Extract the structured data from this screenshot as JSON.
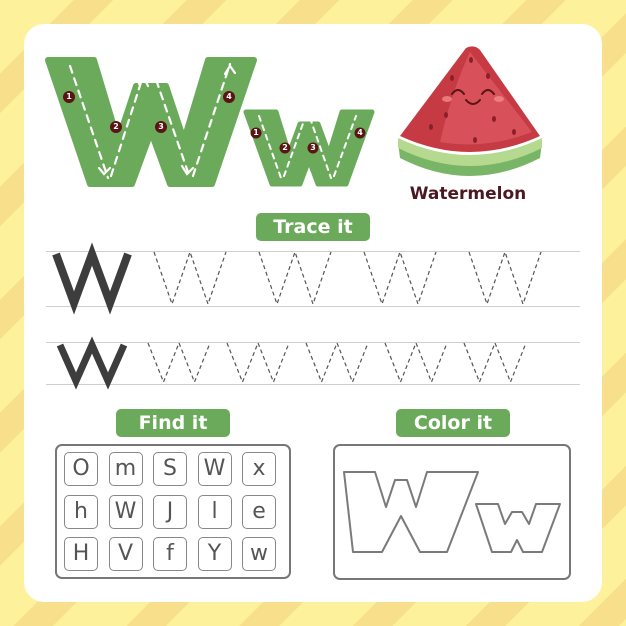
{
  "worksheet": {
    "letter_upper": "W",
    "letter_lower": "w",
    "word": "Watermelon",
    "colors": {
      "background": "#fdf19c",
      "stripe": "#f7df8c",
      "accent_green": "#6aaa5a",
      "step_marker": "#5a1414",
      "word_text": "#4a1a22",
      "melon_red": "#d8464f",
      "rind_light": "#b5d98f",
      "rind_dark": "#79b567"
    },
    "stroke_steps": {
      "upper": [
        "1",
        "2",
        "3",
        "4"
      ],
      "lower": [
        "1",
        "2",
        "3",
        "4"
      ]
    }
  },
  "sections": {
    "trace": {
      "label": "Trace it",
      "rows": [
        {
          "model": "W",
          "trace_count": 4
        },
        {
          "model": "w",
          "trace_count": 5
        }
      ]
    },
    "find": {
      "label": "Find it",
      "grid": [
        [
          "O",
          "m",
          "S",
          "W",
          "x"
        ],
        [
          "h",
          "W",
          "J",
          "l",
          "e"
        ],
        [
          "H",
          "V",
          "f",
          "Y",
          "w"
        ]
      ]
    },
    "color": {
      "label": "Color it",
      "outline_upper": "W",
      "outline_lower": "w"
    }
  }
}
